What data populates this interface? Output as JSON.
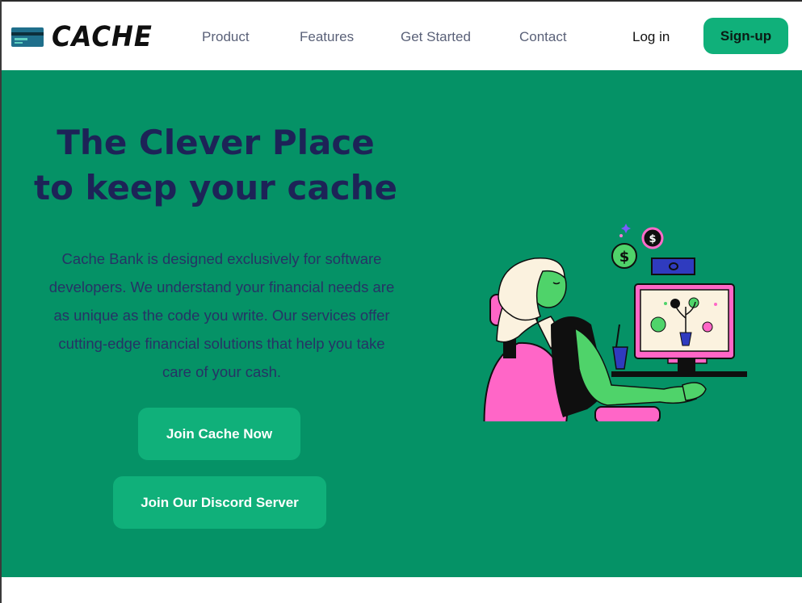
{
  "brand": {
    "name": "CACHE",
    "icon": "credit-card-icon",
    "accent": "#10b07a",
    "hero_bg": "#059266",
    "heading_color": "#1d2357"
  },
  "nav": {
    "items": [
      {
        "label": "Product"
      },
      {
        "label": "Features"
      },
      {
        "label": "Get Started"
      },
      {
        "label": "Contact"
      }
    ]
  },
  "auth": {
    "login_label": "Log in",
    "signup_label": "Sign-up"
  },
  "hero": {
    "title_line1": "The Clever Place",
    "title_line2": "to keep your cache",
    "description": "Cache Bank is designed exclusively for software developers. We understand your financial needs are as unique as the code you write. Our services offer cutting-edge financial solutions that help you take care of your cash.",
    "cta_primary": "Join Cache Now",
    "cta_secondary": "Join Our Discord Server",
    "illustration": "person-at-computer-illustration"
  }
}
